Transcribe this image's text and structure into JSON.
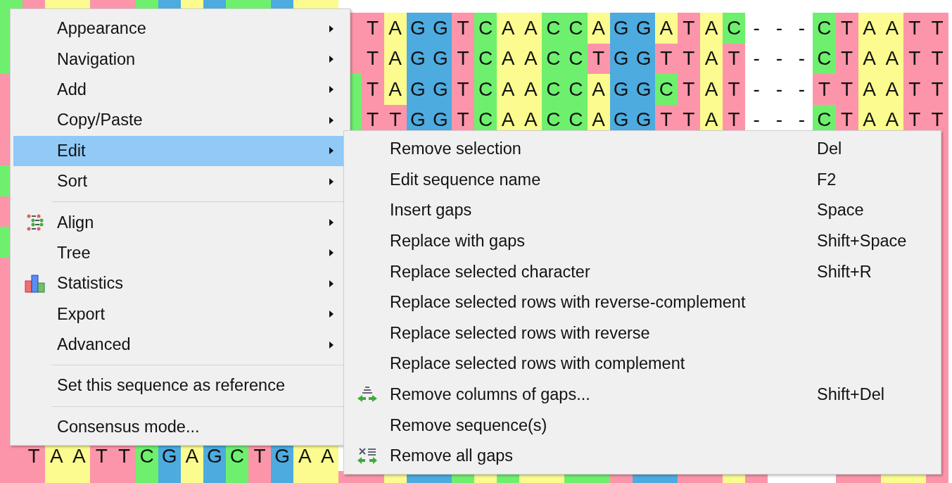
{
  "alignment": {
    "rows": [
      {
        "left": [
          {
            "kind": "shade",
            "cells": [
              {
                "color": "#6ef06e"
              },
              {
                "color": "#fd95aa"
              },
              {
                "color": "#fbfb8f"
              },
              {
                "color": "#fbfb8f"
              },
              {
                "color": "#fd95aa"
              },
              {
                "color": "#fd95aa"
              },
              {
                "color": "#6ef06e"
              },
              {
                "color": "#4dabe0"
              },
              {
                "color": "#fbfb8f"
              },
              {
                "color": "#4dabe0"
              },
              {
                "color": "#6ef06e"
              },
              {
                "color": "#6ef06e"
              },
              {
                "color": "#4dabe0"
              },
              {
                "color": "#fbfb8f"
              },
              {
                "color": "#fbfb8f"
              }
            ]
          }
        ]
      },
      {
        "left": [
          {
            "kind": "shade",
            "cells": [
              {
                "color": "#6ef06e"
              }
            ]
          }
        ],
        "right": [
          {
            "kind": "shade",
            "cells": [
              {
                "color": "#fd95aa"
              }
            ]
          },
          {
            "kind": "bases",
            "text": "T A G G T C A A C C A G G A T A C - - - C T A A T T"
          }
        ]
      },
      {
        "left": [
          {
            "kind": "shade",
            "cells": [
              {
                "color": "#6ef06e"
              }
            ]
          }
        ],
        "right": [
          {
            "kind": "shade",
            "cells": [
              {
                "color": "#fd95aa"
              }
            ]
          },
          {
            "kind": "bases",
            "text": "T A G G T C A A C C T G G T T A T - - - C T A A T T"
          }
        ]
      },
      {
        "left": [
          {
            "kind": "shade",
            "cells": [
              {
                "color": "#fd95aa"
              }
            ]
          }
        ],
        "right": [
          {
            "kind": "shade",
            "cells": [
              {
                "color": "#6ef06e"
              }
            ]
          },
          {
            "kind": "bases",
            "text": "T A G G T C A A C C A G G C T A T - - - T T A A T T"
          }
        ]
      },
      {
        "left": [
          {
            "kind": "shade",
            "cells": [
              {
                "color": "#fd95aa"
              }
            ]
          }
        ],
        "right": [
          {
            "kind": "shade",
            "cells": [
              {
                "color": "#6ef06e"
              }
            ]
          },
          {
            "kind": "bases",
            "text": "T T G G T C A A C C A G G T T A T - - - C T A A T T"
          }
        ]
      },
      {
        "left": [
          {
            "kind": "shade",
            "cells": [
              {
                "color": "#fd95aa"
              }
            ]
          }
        ],
        "right": [
          {
            "kind": "shade",
            "cells": [
              {
                "color": "#fd95aa"
              }
            ]
          }
        ]
      },
      {
        "left": [
          {
            "kind": "shade",
            "cells": [
              {
                "color": "#6ef06e"
              }
            ]
          }
        ],
        "right": [
          {
            "kind": "shade",
            "cells": [
              {
                "color": "#fd95aa"
              }
            ]
          }
        ]
      },
      {
        "left": [
          {
            "kind": "shade",
            "cells": [
              {
                "color": "#fd95aa"
              }
            ]
          }
        ],
        "right": [
          {
            "kind": "shade",
            "cells": [
              {
                "color": "#fd95aa"
              }
            ]
          }
        ]
      },
      {
        "left": [
          {
            "kind": "shade",
            "cells": [
              {
                "color": "#6ef06e"
              }
            ]
          }
        ],
        "right": [
          {
            "kind": "shade",
            "cells": [
              {
                "color": "#fd95aa"
              }
            ]
          }
        ]
      },
      {
        "left": [
          {
            "kind": "shade",
            "cells": [
              {
                "color": "#fd95aa"
              }
            ]
          }
        ],
        "right": [
          {
            "kind": "shade",
            "cells": [
              {
                "color": "#fd95aa"
              }
            ]
          }
        ]
      },
      {
        "left": [
          {
            "kind": "shade",
            "cells": [
              {
                "color": "#fd95aa"
              }
            ]
          }
        ],
        "right": [
          {
            "kind": "shade",
            "cells": [
              {
                "color": "#fd95aa"
              }
            ]
          }
        ]
      },
      {
        "left": [
          {
            "kind": "shade",
            "cells": [
              {
                "color": "#fd95aa"
              }
            ]
          }
        ],
        "right": [
          {
            "kind": "shade",
            "cells": [
              {
                "color": "#fd95aa"
              }
            ]
          }
        ]
      },
      {
        "left": [
          {
            "kind": "shade",
            "cells": [
              {
                "color": "#fd95aa"
              }
            ]
          }
        ],
        "right": [
          {
            "kind": "shade",
            "cells": [
              {
                "color": "#fd95aa"
              }
            ]
          }
        ]
      },
      {
        "left": [
          {
            "kind": "shade",
            "cells": [
              {
                "color": "#fd95aa"
              }
            ]
          }
        ],
        "right": [
          {
            "kind": "shade",
            "cells": [
              {
                "color": "#fd95aa"
              }
            ]
          }
        ]
      },
      {
        "left": [
          {
            "kind": "shade",
            "cells": [
              {
                "color": "#fd95aa"
              }
            ]
          }
        ],
        "right": [
          {
            "kind": "shade",
            "cells": [
              {
                "color": "#fd95aa"
              }
            ]
          }
        ]
      },
      {
        "left": [
          {
            "kind": "shade",
            "cells": [
              {
                "color": "#fd95aa"
              }
            ]
          },
          {
            "kind": "bases",
            "text": "T A A T T C G A G C T G A A"
          }
        ],
        "right": [
          {
            "kind": "shade",
            "cells": [
              {
                "color": "#fd95aa"
              }
            ]
          }
        ]
      },
      {
        "left": [
          {
            "kind": "shade",
            "cells": [
              {
                "color": "#fd95aa"
              },
              {
                "color": "#fd95aa"
              },
              {
                "color": "#fbfb8f"
              },
              {
                "color": "#fbfb8f"
              },
              {
                "color": "#fd95aa"
              },
              {
                "color": "#fd95aa"
              },
              {
                "color": "#6ef06e"
              },
              {
                "color": "#4dabe0"
              },
              {
                "color": "#fbfb8f"
              },
              {
                "color": "#4dabe0"
              },
              {
                "color": "#6ef06e"
              },
              {
                "color": "#fd95aa"
              },
              {
                "color": "#4dabe0"
              },
              {
                "color": "#fbfb8f"
              },
              {
                "color": "#fbfb8f"
              },
              {
                "color": "#fd95aa"
              },
              {
                "color": "#fd95aa"
              },
              {
                "color": "#fbfb8f"
              },
              {
                "color": "#4dabe0"
              },
              {
                "color": "#4dabe0"
              },
              {
                "color": "#6ef06e"
              },
              {
                "color": "#fbfb8f"
              },
              {
                "color": "#6ef06e"
              },
              {
                "color": "#fbfb8f"
              },
              {
                "color": "#fbfb8f"
              },
              {
                "color": "#6ef06e"
              },
              {
                "color": "#6ef06e"
              },
              {
                "color": "#fd95aa"
              },
              {
                "color": "#4dabe0"
              },
              {
                "color": "#4dabe0"
              },
              {
                "color": "#fd95aa"
              },
              {
                "color": "#fd95aa"
              },
              {
                "color": "#fbfb8f"
              },
              {
                "color": "#fd95aa"
              }
            ]
          }
        ],
        "right": [
          {
            "kind": "shade",
            "cells": [
              {
                "color": "#fd95aa"
              },
              {
                "color": "#fd95aa"
              },
              {
                "color": "#fbfb8f"
              },
              {
                "color": "#fbfb8f"
              },
              {
                "color": "#fd95aa"
              }
            ]
          }
        ]
      }
    ]
  },
  "context_menu": {
    "items": [
      {
        "kind": "item",
        "label": "Appearance",
        "has_submenu": true,
        "selected": false
      },
      {
        "kind": "item",
        "label": "Navigation",
        "has_submenu": true,
        "selected": false
      },
      {
        "kind": "item",
        "label": "Add",
        "has_submenu": true,
        "selected": false
      },
      {
        "kind": "item",
        "label": "Copy/Paste",
        "has_submenu": true,
        "selected": false
      },
      {
        "kind": "item",
        "label": "Edit",
        "has_submenu": true,
        "selected": true
      },
      {
        "kind": "item",
        "label": "Sort",
        "has_submenu": true,
        "selected": false
      },
      {
        "kind": "separator"
      },
      {
        "kind": "item",
        "label": "Align",
        "has_submenu": true,
        "selected": false
      },
      {
        "kind": "item",
        "label": "Tree",
        "has_submenu": true,
        "selected": false
      },
      {
        "kind": "item",
        "label": "Statistics",
        "has_submenu": true,
        "selected": false
      },
      {
        "kind": "item",
        "label": "Export",
        "has_submenu": true,
        "selected": false
      },
      {
        "kind": "item",
        "label": "Advanced",
        "has_submenu": true,
        "selected": false
      },
      {
        "kind": "separator"
      },
      {
        "kind": "item",
        "label": "Set this sequence as reference",
        "has_submenu": false,
        "selected": false
      },
      {
        "kind": "separator"
      },
      {
        "kind": "item",
        "label": "Consensus mode...",
        "has_submenu": false,
        "selected": false
      }
    ]
  },
  "edit_submenu": {
    "items": [
      {
        "label": "Remove selection",
        "shortcut": "Del"
      },
      {
        "label": "Edit sequence name",
        "shortcut": "F2"
      },
      {
        "label": "Insert gaps",
        "shortcut": "Space"
      },
      {
        "label": "Replace with gaps",
        "shortcut": "Shift+Space"
      },
      {
        "label": "Replace selected character",
        "shortcut": "Shift+R"
      },
      {
        "label": "Replace selected rows with reverse-complement"
      },
      {
        "label": "Replace selected rows with reverse"
      },
      {
        "label": "Replace selected rows with complement"
      },
      {
        "label": "Remove columns of gaps...",
        "shortcut": "Shift+Del"
      },
      {
        "label": "Remove sequence(s)"
      },
      {
        "label": "Remove all gaps"
      }
    ]
  }
}
